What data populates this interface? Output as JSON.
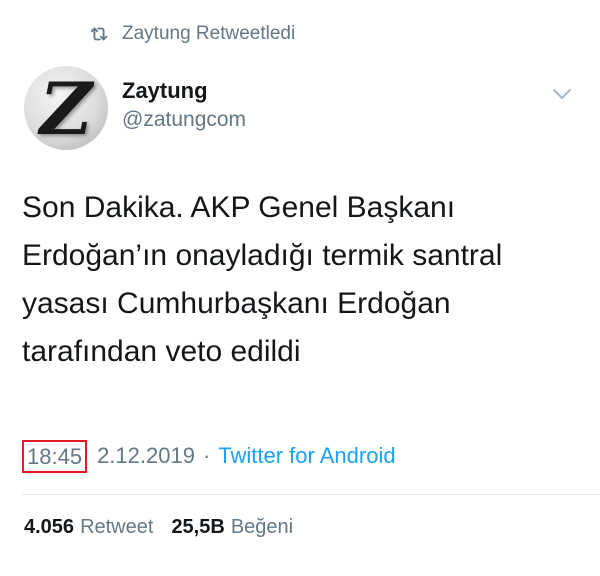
{
  "retweet_banner": {
    "icon": "retweet-icon",
    "text": "Zaytung Retweetledi"
  },
  "author": {
    "avatar_letter": "Z",
    "display_name": "Zaytung",
    "handle": "@zatungcom"
  },
  "menu": {
    "icon": "chevron-down-icon"
  },
  "tweet": {
    "lines": [
      "Son Dakika. AKP Genel Başkanı",
      "Erdoğan’ın onayladığı termik santral",
      "yasası Cumhurbaşkanı Erdoğan",
      "tarafından veto edildi"
    ]
  },
  "meta": {
    "time": "18:45",
    "date": "2.12.2019",
    "separator": "·",
    "source": "Twitter for Android"
  },
  "stats": {
    "retweet_count": "4.056",
    "retweet_label": "Retweet",
    "like_count": "25,5B",
    "like_label": "Beğeni"
  },
  "colors": {
    "text_primary": "#14171a",
    "text_secondary": "#657786",
    "link": "#1da1f2",
    "highlight_box": "#e01b24",
    "divider": "#e1e8ed"
  }
}
